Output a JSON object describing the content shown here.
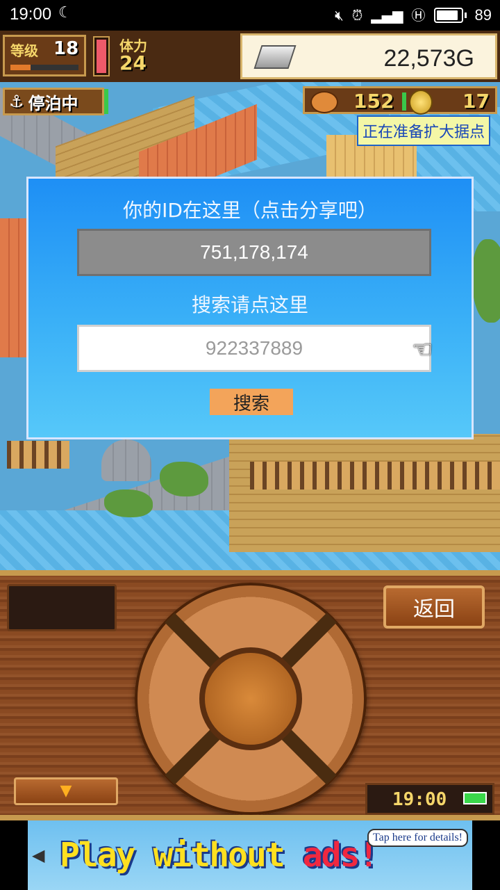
{
  "status_bar": {
    "time": "19:00",
    "battery": "89"
  },
  "hud": {
    "level_label": "等级",
    "level": "18",
    "level_progress": 0.3,
    "stamina_label": "体力",
    "stamina": "24",
    "gold": "22,573G",
    "docked_label": "停泊中",
    "food": "152",
    "coins": "17",
    "notice": "正在准备扩大据点"
  },
  "dialog": {
    "title": "你的ID在这里（点击分享吧）",
    "id_value": "751,178,174",
    "search_prompt": "搜索请点这里",
    "search_placeholder": "922337889",
    "search_button": "搜索"
  },
  "controller": {
    "back_button": "返回",
    "down_arrow": "▼",
    "clock": "19:00"
  },
  "ad": {
    "text_main": "Play without ",
    "text_red": "ads!",
    "tap_text": "Tap here for details!"
  }
}
